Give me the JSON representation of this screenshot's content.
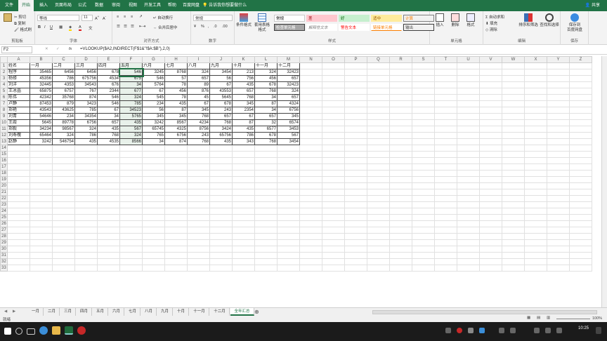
{
  "tabs": [
    "文件",
    "开始",
    "插入",
    "页面布局",
    "公式",
    "数据",
    "审阅",
    "视图",
    "开发工具",
    "帮助",
    "百度网盘"
  ],
  "active_tab": "开始",
  "tell_me": "告诉我你想要做什么",
  "share": "共享",
  "ribbon": {
    "clipboard": {
      "cut": "剪切",
      "copy": "复制",
      "paint": "格式刷",
      "label": "剪贴板"
    },
    "font": {
      "name": "等线",
      "size": "11",
      "label": "字体"
    },
    "alignment": {
      "wrap": "自动换行",
      "merge": "合并后居中",
      "label": "对齐方式"
    },
    "number": {
      "format": "常规",
      "label": "数字"
    },
    "styles": {
      "cond": "条件格式",
      "table": "套用表格格式",
      "cells": [
        [
          "常规",
          "差",
          "好",
          "适中",
          "计算"
        ],
        [
          "检查单元格",
          "解释性文本",
          "警告文本",
          "链接单元格",
          "输出"
        ]
      ],
      "label": "样式"
    },
    "cells_group": {
      "insert": "插入",
      "delete": "删除",
      "format": "格式",
      "label": "单元格"
    },
    "editing": {
      "autosum": "自动求和",
      "fill": "填充",
      "clear": "清除",
      "sort": "排序和筛选",
      "find": "查找和选择",
      "label": "编辑"
    },
    "save": {
      "line1": "保存到",
      "line2": "百度网盘",
      "label": "保存"
    }
  },
  "name_box": "F2",
  "formula": "=VLOOKUP($A2,INDIRECT(F$1&\"!$A:$B\"),2,0)",
  "columns": [
    "A",
    "B",
    "C",
    "D",
    "E",
    "F",
    "G",
    "H",
    "I",
    "J",
    "K",
    "L",
    "M",
    "N",
    "O",
    "P",
    "Q",
    "R",
    "S",
    "T",
    "U",
    "V",
    "W",
    "X",
    "Y",
    "Z"
  ],
  "header": [
    "姓名",
    "一月",
    "二月",
    "三月",
    "四月",
    "五月",
    "六月",
    "七月",
    "八月",
    "九月",
    "十月",
    "十一月",
    "十二月"
  ],
  "rows": [
    [
      "程序",
      35465,
      6456,
      6456,
      678,
      546,
      3245,
      8768,
      324,
      3454,
      213,
      324,
      32423
    ],
    [
      "杨修",
      45356,
      786,
      675756,
      4534,
      675,
      546,
      57,
      657,
      56,
      756,
      456,
      657
    ],
    [
      "刘洋",
      32445,
      4353,
      34543,
      676,
      34,
      5764,
      78,
      89,
      67,
      435,
      678,
      32423
    ],
    [
      "王冰晶",
      65875,
      6757,
      767,
      2344,
      677,
      67,
      456,
      876,
      43553,
      657,
      768,
      324
    ],
    [
      "陈伟",
      42342,
      35768,
      874,
      546,
      324,
      545,
      78,
      45,
      5645,
      768,
      34,
      657
    ],
    [
      "卢静",
      87453,
      879,
      3423,
      546,
      785,
      234,
      435,
      67,
      678,
      345,
      87,
      4324
    ],
    [
      "郑艳",
      43543,
      43625,
      785,
      67,
      34523,
      56,
      87,
      345,
      243,
      2354,
      34,
      6756
    ],
    [
      "刘青",
      54646,
      234,
      34354,
      34,
      5765,
      345,
      345,
      768,
      657,
      67,
      657,
      345
    ],
    [
      "王霞",
      5645,
      89778,
      6756,
      657,
      435,
      3242,
      8567,
      4234,
      768,
      87,
      32,
      6574
    ],
    [
      "郑毅",
      34234,
      98567,
      324,
      435,
      567,
      65745,
      4325,
      8756,
      3424,
      435,
      6577,
      3453
    ],
    [
      "刘寿槐",
      65464,
      324,
      786,
      768,
      324,
      765,
      6756,
      243,
      65756,
      786,
      678,
      567
    ],
    [
      "赵静",
      3242,
      546754,
      435,
      4535,
      8566,
      34,
      874,
      768,
      435,
      343,
      768,
      3454
    ]
  ],
  "total_rows": 33,
  "sheet_tabs": [
    "一月",
    "二月",
    "三月",
    "四月",
    "五月",
    "六月",
    "七月",
    "八月",
    "九月",
    "十月",
    "十一月",
    "十二月",
    "全年汇总"
  ],
  "active_sheet": "全年汇总",
  "status": {
    "left": "就绪",
    "zoom": "100%"
  },
  "clock": "10:25"
}
